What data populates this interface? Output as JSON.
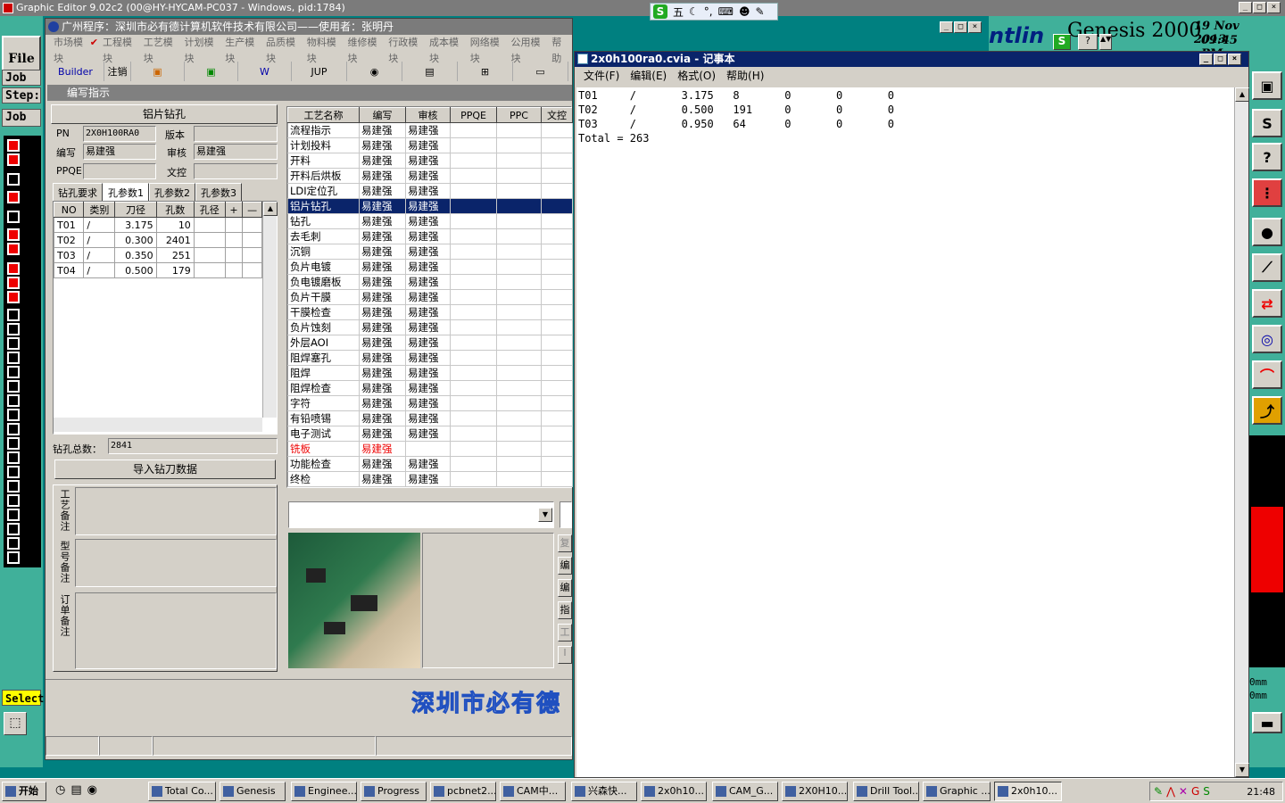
{
  "outer_title": "Graphic Editor 9.02c2 (00@HY-HYCAM-PC037 - Windows, pid:1784)",
  "ime": {
    "mode": "五",
    "label": "S"
  },
  "genesis": {
    "file": "File",
    "job": "Job",
    "step": "Step:",
    "job2": "Job",
    "select": "Select",
    "brand": "Genesis 2000",
    "brand2": "ntlin",
    "date": "19 Nov 2013",
    "time": "09:45 PM",
    "mm1": "0mm",
    "mm2": "0mm"
  },
  "app": {
    "title": "广州程序：深圳市必有德计算机软件技术有限公司——使用者：张明丹",
    "menu": [
      "市场模块",
      "工程模块",
      "工艺模块",
      "计划模块",
      "生产模块",
      "品质模块",
      "物料模块",
      "维修模块",
      "行政模块",
      "成本模块",
      "网络模块",
      "公用模块",
      "帮助"
    ],
    "toolbar": {
      "builder": "Builder",
      "logout": "注销",
      "jup": "JUP"
    },
    "sub_title": "编写指示",
    "section": "铝片钻孔",
    "form": {
      "pn_l": "PN",
      "pn": "2X0H100RA0",
      "ver_l": "版本",
      "ver": "",
      "write_l": "编写",
      "write": "易建强",
      "review_l": "审核",
      "review": "易建强",
      "ppqe_l": "PPQE",
      "ppqe": "",
      "ctrl_l": "文控",
      "ctrl": ""
    },
    "tabs": [
      "钻孔要求",
      "孔参数1",
      "孔参数2",
      "孔参数3"
    ],
    "hole_headers": [
      "NO",
      "类别",
      "刀径",
      "孔数",
      "孔径",
      "+",
      "—"
    ],
    "holes": [
      [
        "T01",
        "/",
        "3.175",
        "10"
      ],
      [
        "T02",
        "/",
        "0.300",
        "2401"
      ],
      [
        "T03",
        "/",
        "0.350",
        "251"
      ],
      [
        "T04",
        "/",
        "0.500",
        "179"
      ]
    ],
    "total_l": "钻孔总数：",
    "total": "2841",
    "import_btn": "导入钻刀数据",
    "notes": [
      "工艺备注",
      "型号备注",
      "订单备注"
    ],
    "proc_headers": [
      "工艺名称",
      "编写",
      "审核",
      "PPQE",
      "PPC",
      "文控"
    ],
    "proc": [
      [
        "流程指示",
        "易建强",
        "易建强"
      ],
      [
        "计划投料",
        "易建强",
        "易建强"
      ],
      [
        "开料",
        "易建强",
        "易建强"
      ],
      [
        "开料后烘板",
        "易建强",
        "易建强"
      ],
      [
        "LDI定位孔",
        "易建强",
        "易建强"
      ],
      [
        "铝片钻孔",
        "易建强",
        "易建强"
      ],
      [
        "钻孔",
        "易建强",
        "易建强"
      ],
      [
        "去毛刺",
        "易建强",
        "易建强"
      ],
      [
        "沉铜",
        "易建强",
        "易建强"
      ],
      [
        "负片电镀",
        "易建强",
        "易建强"
      ],
      [
        "负电镀磨板",
        "易建强",
        "易建强"
      ],
      [
        "负片干膜",
        "易建强",
        "易建强"
      ],
      [
        "干膜检查",
        "易建强",
        "易建强"
      ],
      [
        "负片蚀刻",
        "易建强",
        "易建强"
      ],
      [
        "外层AOI",
        "易建强",
        "易建强"
      ],
      [
        "阻焊塞孔",
        "易建强",
        "易建强"
      ],
      [
        "阻焊",
        "易建强",
        "易建强"
      ],
      [
        "阻焊检查",
        "易建强",
        "易建强"
      ],
      [
        "字符",
        "易建强",
        "易建强"
      ],
      [
        "有铅喷锡",
        "易建强",
        "易建强"
      ],
      [
        "电子测试",
        "易建强",
        "易建强"
      ],
      [
        "铣板",
        "易建强",
        ""
      ],
      [
        "功能检查",
        "易建强",
        "易建强"
      ],
      [
        "终检",
        "易建强",
        "易建强"
      ]
    ],
    "side_btns": [
      "复",
      "编",
      "编",
      "指",
      "工",
      "I"
    ],
    "banner": "深圳市必有德"
  },
  "notepad": {
    "title": "2x0h100ra0.cvia - 记事本",
    "menu": [
      "文件(F)",
      "编辑(E)",
      "格式(O)",
      "帮助(H)"
    ],
    "content": "T01     /       3.175   8       0       0       0\nT02     /       0.500   191     0       0       0\nT03     /       0.950   64      0       0       0\nTotal = 263"
  },
  "taskbar": {
    "start": "开始",
    "clock": "21:48",
    "items": [
      "Total Co...",
      "Genesis",
      "Enginee...",
      "Progress",
      "pcbnet2...",
      "CAM中...",
      "兴森快...",
      "2x0h10...",
      "CAM_G...",
      "2X0H10...",
      "Drill Tool...",
      "Graphic ...",
      "2x0h10..."
    ]
  }
}
